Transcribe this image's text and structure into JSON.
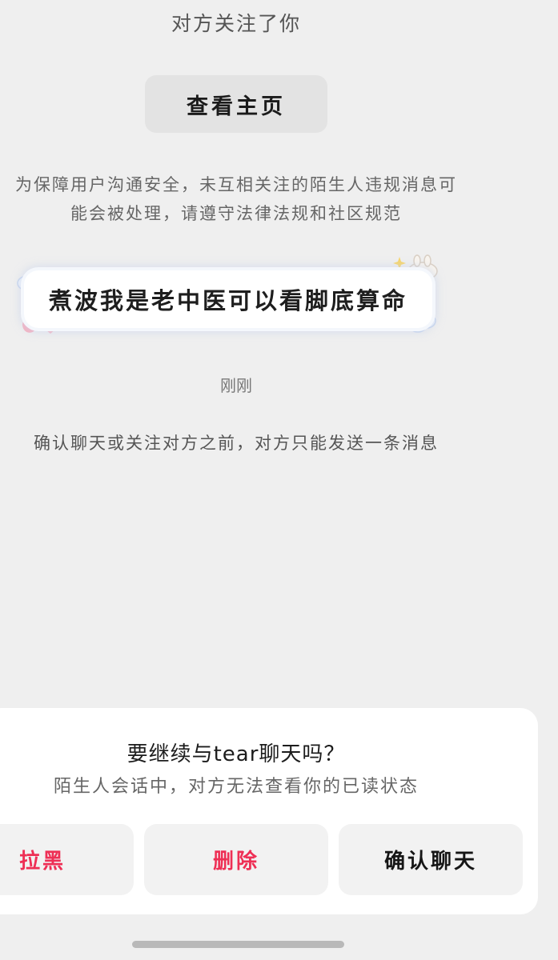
{
  "conversation": {
    "follow_notice": "对方关注了你",
    "view_profile_label": "查看主页",
    "safety_notice_line1": "为保障用户沟通安全，未互相关注的陌生人违规消息可",
    "safety_notice_line2": "能会被处理，请遵守法律法规和社区规范",
    "message_text": "煮波我是老中医可以看脚底算命",
    "timestamp": "刚刚",
    "limit_notice": "确认聊天或关注对方之前，对方只能发送一条消息"
  },
  "dialog": {
    "title": "要继续与tear聊天吗？",
    "subtitle": "陌生人会话中，对方无法查看你的已读状态",
    "block_label": "拉黑",
    "delete_label": "删除",
    "confirm_label": "确认聊天"
  },
  "colors": {
    "background": "#efefef",
    "danger": "#ee2f55",
    "sheet": "#ffffff"
  },
  "icons": {
    "bubble_decorations": [
      "cloud",
      "strawberry",
      "heart",
      "star",
      "bunny"
    ]
  }
}
